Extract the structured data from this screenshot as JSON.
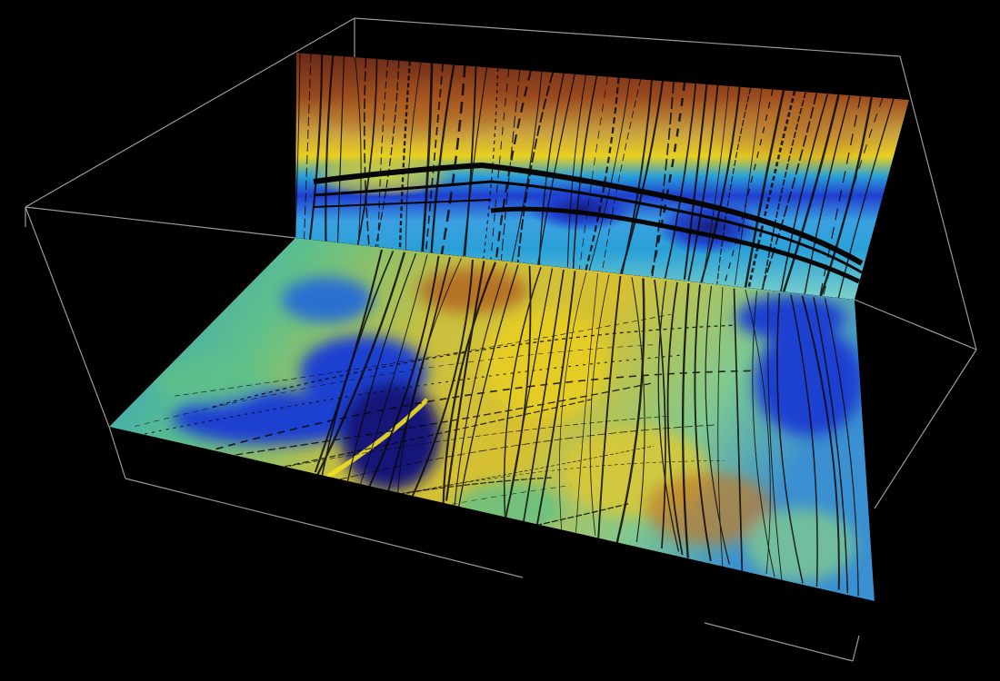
{
  "scene": {
    "subject": "3d-seismic-volume",
    "colors": {
      "background": "#000000",
      "bounding_box_stroke": "#9a9a9a",
      "fault_lines": "#0a0704",
      "horizon": "#050505",
      "colormap": [
        "#12127a",
        "#1f3fd0",
        "#2aa0d8",
        "#7fd3c8",
        "#c8e34a",
        "#f0e020",
        "#d08a2a",
        "#9a4a1e",
        "#6a2a18"
      ]
    }
  }
}
